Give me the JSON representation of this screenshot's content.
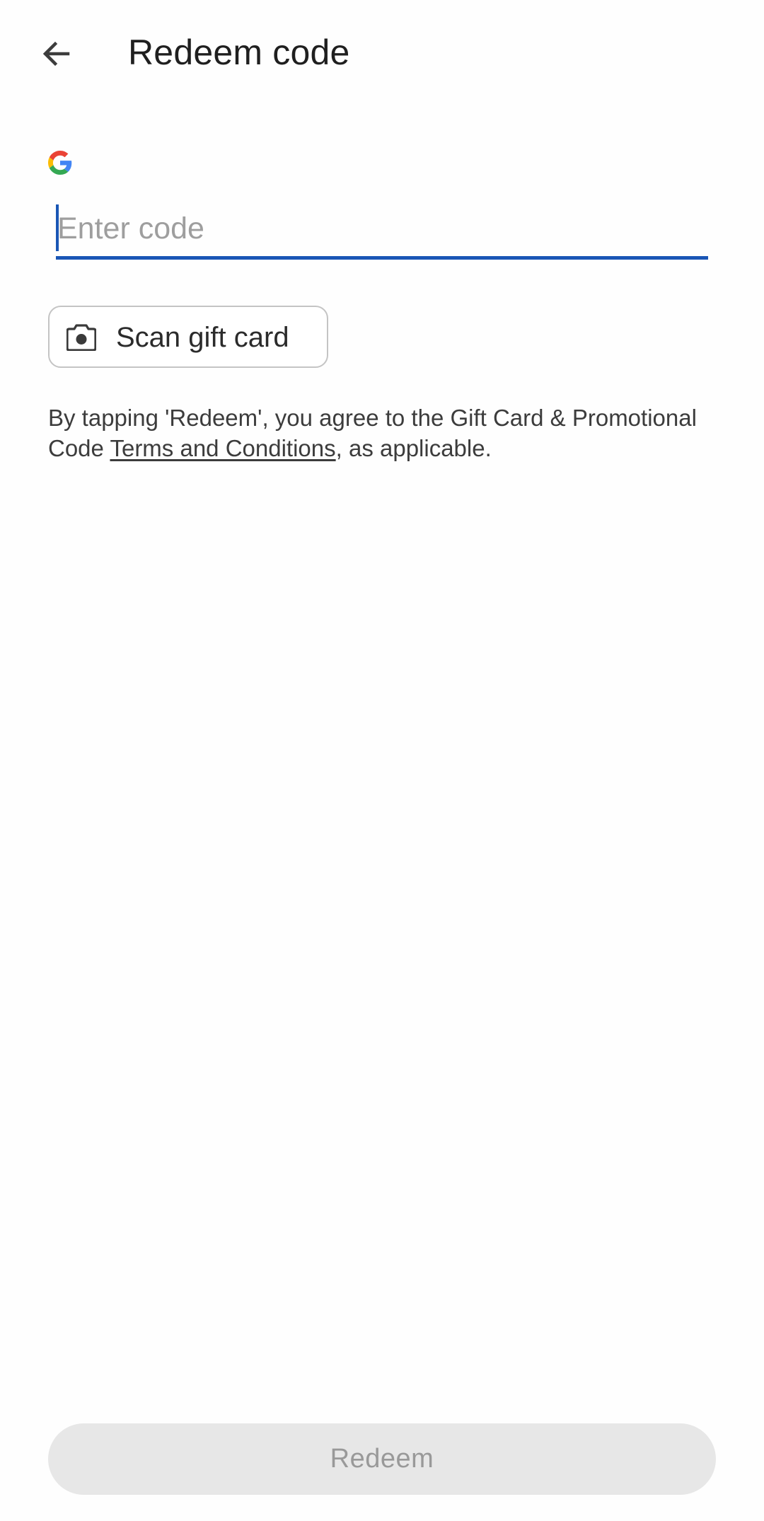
{
  "header": {
    "title": "Redeem code",
    "back_icon": "arrow-back-icon"
  },
  "brand": {
    "logo_icon": "google-g-logo",
    "colors": {
      "blue": "#4285F4",
      "red": "#EA4335",
      "yellow": "#FBBC05",
      "green": "#34A853"
    }
  },
  "code_input": {
    "value": "",
    "placeholder": "Enter code",
    "focused": true,
    "accent_color": "#1a56b5"
  },
  "scan_button": {
    "label": "Scan gift card",
    "icon": "camera-icon"
  },
  "terms": {
    "prefix": "By tapping 'Redeem', you agree to the Gift Card & Promotional Code ",
    "link_text": "Terms and Conditions",
    "suffix": ", as applicable."
  },
  "redeem_button": {
    "label": "Redeem",
    "enabled": false
  }
}
